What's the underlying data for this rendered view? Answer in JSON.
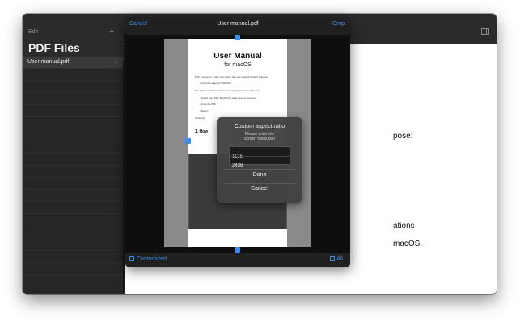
{
  "sidebar": {
    "edit_label": "Edit",
    "add_label": "+",
    "title": "PDF Files",
    "selected_item": "User manual.pdf",
    "chevron": "›"
  },
  "toolbar": {
    "left_icon": "crop-rotate-icon",
    "right_icon": "sidebar-toggle-icon"
  },
  "background_doc": {
    "line_pose": "pose:",
    "line_ations": "ations",
    "line_macos": "macOS."
  },
  "sheet": {
    "cancel_label": "Cancel",
    "title": "User manual.pdf",
    "crop_label": "Crop",
    "customized_label": "Customized",
    "all_label": "All"
  },
  "document": {
    "title": "User Manual",
    "subtitle": "for macOS",
    "intro": "PDF Cropper is a utility app which has one straight forward purpose:",
    "bullet1": "• Crop the edges of PDF files.",
    "workflow": "The typical workflow of this app is simply made up of 3 steps:",
    "step1": "• Import your PDF file(s) from other apps or locations",
    "step2": "• Crop the PDF",
    "step3": "• Export",
    "contents": "Contents",
    "section": "1. How"
  },
  "dialog": {
    "title": "Custom aspect ratio",
    "message_line1": "Please enter the",
    "message_line2": "screen resolution",
    "width_value": "1125",
    "height_value": "2436",
    "done_label": "Done",
    "cancel_label": "Cancel"
  },
  "colors": {
    "accent": "#3b8eea",
    "window_bg": "#1e1e1e",
    "sidebar_bg": "#262626"
  }
}
